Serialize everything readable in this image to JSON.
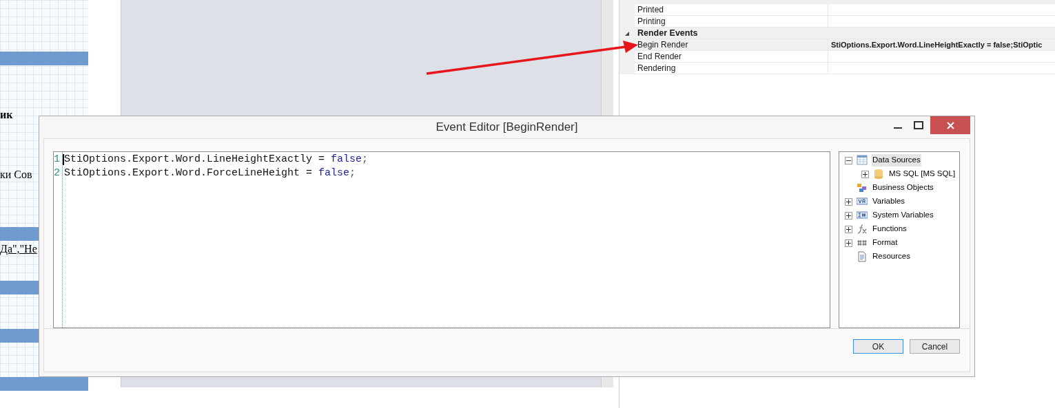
{
  "report_page": {
    "texts": [
      {
        "text": "ик",
        "kind": "bold"
      },
      {
        "text": "ки Сов",
        "kind": "plain"
      },
      {
        "text": "Да\",\"Не",
        "kind": "underline"
      }
    ]
  },
  "property_grid": {
    "rows": [
      {
        "kind": "group",
        "label": ""
      },
      {
        "kind": "item",
        "label": "Printed",
        "value": "",
        "selected": false
      },
      {
        "kind": "item",
        "label": "Printing",
        "value": "",
        "selected": false
      },
      {
        "kind": "group",
        "label": "Render  Events",
        "expanded": true
      },
      {
        "kind": "item",
        "label": "Begin Render",
        "value": "StiOptions.Export.Word.LineHeightExactly = false;StiOptic",
        "selected": true
      },
      {
        "kind": "item",
        "label": "End Render",
        "value": "",
        "selected": false
      },
      {
        "kind": "item",
        "label": "Rendering",
        "value": "",
        "selected": false
      }
    ]
  },
  "dialog": {
    "title": "Event Editor [BeginRender]",
    "code_lines": [
      {
        "number": "1",
        "code": "StiOptions.Export.Word.LineHeightExactly = ",
        "keyword": "false",
        "end": ";"
      },
      {
        "number": "2",
        "code": "StiOptions.Export.Word.ForceLineHeight = ",
        "keyword": "false",
        "end": ";"
      }
    ],
    "tree": [
      {
        "label": "Data Sources",
        "kind": "table",
        "expanded": true,
        "selected": true,
        "children": [
          {
            "label": "MS SQL [MS SQL]",
            "kind": "database",
            "expanded": false,
            "selected": false
          }
        ]
      },
      {
        "label": "Business Objects",
        "kind": "objects",
        "selected": false
      },
      {
        "label": "Variables",
        "kind": "var",
        "expanded": false,
        "selected": false
      },
      {
        "label": "System Variables",
        "kind": "sysvar",
        "expanded": false,
        "selected": false
      },
      {
        "label": "Functions",
        "kind": "fx",
        "expanded": false,
        "selected": false
      },
      {
        "label": "Format",
        "kind": "format",
        "expanded": false,
        "selected": false
      },
      {
        "label": "Resources",
        "kind": "doc",
        "selected": false
      }
    ],
    "buttons": [
      {
        "label": "OK",
        "default": true
      },
      {
        "label": "Cancel",
        "default": false
      }
    ]
  }
}
